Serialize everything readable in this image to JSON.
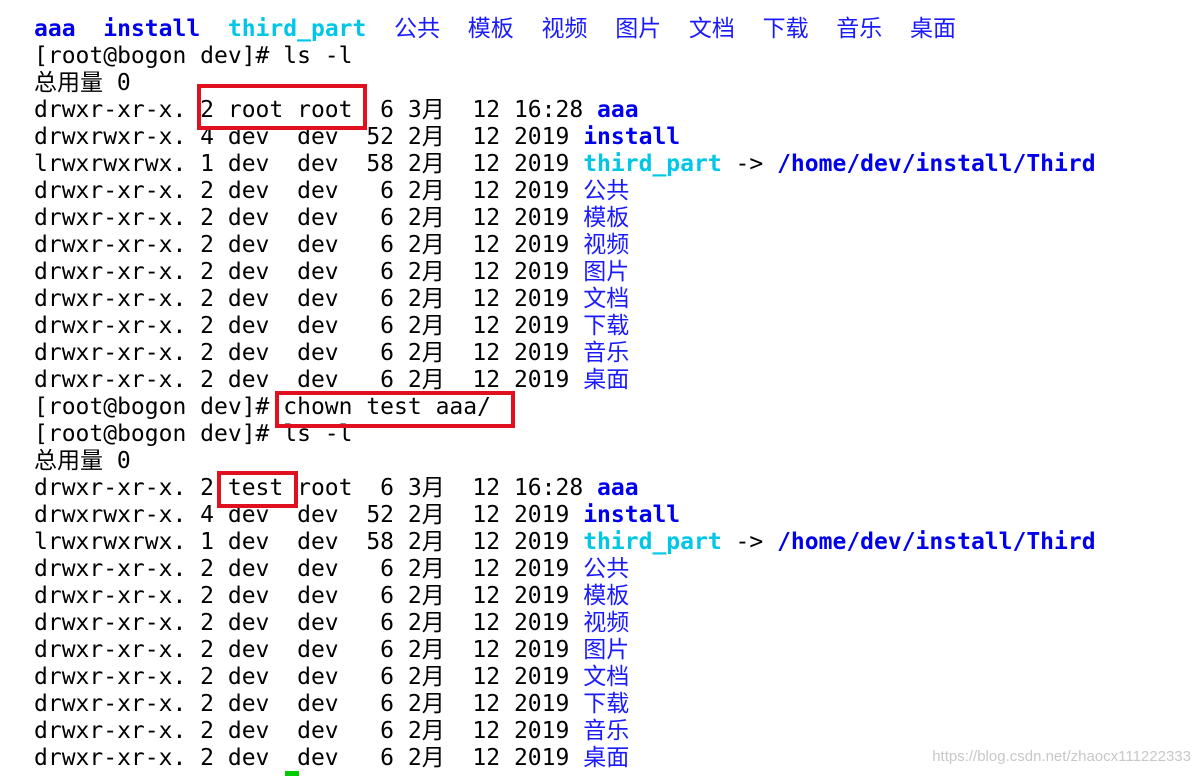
{
  "terminal": {
    "lines": [
      [
        {
          "t": "aaa",
          "s": "dir"
        },
        {
          "t": "  ",
          "s": "plain"
        },
        {
          "t": "install",
          "s": "dir"
        },
        {
          "t": "  ",
          "s": "plain"
        },
        {
          "t": "third_part",
          "s": "link"
        },
        {
          "t": "  ",
          "s": "plain"
        },
        {
          "t": "公共",
          "s": "cn"
        },
        {
          "t": "  ",
          "s": "plain"
        },
        {
          "t": "模板",
          "s": "cn"
        },
        {
          "t": "  ",
          "s": "plain"
        },
        {
          "t": "视频",
          "s": "cn"
        },
        {
          "t": "  ",
          "s": "plain"
        },
        {
          "t": "图片",
          "s": "cn"
        },
        {
          "t": "  ",
          "s": "plain"
        },
        {
          "t": "文档",
          "s": "cn"
        },
        {
          "t": "  ",
          "s": "plain"
        },
        {
          "t": "下载",
          "s": "cn"
        },
        {
          "t": "  ",
          "s": "plain"
        },
        {
          "t": "音乐",
          "s": "cn"
        },
        {
          "t": "  ",
          "s": "plain"
        },
        {
          "t": "桌面",
          "s": "cn"
        }
      ],
      [
        {
          "t": "[root@bogon dev]# ls -l",
          "s": "plain"
        }
      ],
      [
        {
          "t": "总用量 0",
          "s": "plain"
        }
      ],
      [
        {
          "t": "drwxr-xr-x. 2 root root  6 3月  12 16:28 ",
          "s": "plain"
        },
        {
          "t": "aaa",
          "s": "dir"
        }
      ],
      [
        {
          "t": "drwxrwxr-x. 4 dev  dev  52 2月  12 2019 ",
          "s": "plain"
        },
        {
          "t": "install",
          "s": "dir"
        }
      ],
      [
        {
          "t": "lrwxrwxrwx. 1 dev  dev  58 2月  12 2019 ",
          "s": "plain"
        },
        {
          "t": "third_part",
          "s": "link"
        },
        {
          "t": " -> ",
          "s": "plain"
        },
        {
          "t": "/home/dev/install/Third",
          "s": "dir"
        }
      ],
      [
        {
          "t": "drwxr-xr-x. 2 dev  dev   6 2月  12 2019 ",
          "s": "plain"
        },
        {
          "t": "公共",
          "s": "cn"
        }
      ],
      [
        {
          "t": "drwxr-xr-x. 2 dev  dev   6 2月  12 2019 ",
          "s": "plain"
        },
        {
          "t": "模板",
          "s": "cn"
        }
      ],
      [
        {
          "t": "drwxr-xr-x. 2 dev  dev   6 2月  12 2019 ",
          "s": "plain"
        },
        {
          "t": "视频",
          "s": "cn"
        }
      ],
      [
        {
          "t": "drwxr-xr-x. 2 dev  dev   6 2月  12 2019 ",
          "s": "plain"
        },
        {
          "t": "图片",
          "s": "cn"
        }
      ],
      [
        {
          "t": "drwxr-xr-x. 2 dev  dev   6 2月  12 2019 ",
          "s": "plain"
        },
        {
          "t": "文档",
          "s": "cn"
        }
      ],
      [
        {
          "t": "drwxr-xr-x. 2 dev  dev   6 2月  12 2019 ",
          "s": "plain"
        },
        {
          "t": "下载",
          "s": "cn"
        }
      ],
      [
        {
          "t": "drwxr-xr-x. 2 dev  dev   6 2月  12 2019 ",
          "s": "plain"
        },
        {
          "t": "音乐",
          "s": "cn"
        }
      ],
      [
        {
          "t": "drwxr-xr-x. 2 dev  dev   6 2月  12 2019 ",
          "s": "plain"
        },
        {
          "t": "桌面",
          "s": "cn"
        }
      ],
      [
        {
          "t": "[root@bogon dev]# chown test aaa/",
          "s": "plain"
        }
      ],
      [
        {
          "t": "[root@bogon dev]# ls -l",
          "s": "plain"
        }
      ],
      [
        {
          "t": "总用量 0",
          "s": "plain"
        }
      ],
      [
        {
          "t": "drwxr-xr-x. 2 test root  6 3月  12 16:28 ",
          "s": "plain"
        },
        {
          "t": "aaa",
          "s": "dir"
        }
      ],
      [
        {
          "t": "drwxrwxr-x. 4 dev  dev  52 2月  12 2019 ",
          "s": "plain"
        },
        {
          "t": "install",
          "s": "dir"
        }
      ],
      [
        {
          "t": "lrwxrwxrwx. 1 dev  dev  58 2月  12 2019 ",
          "s": "plain"
        },
        {
          "t": "third_part",
          "s": "link"
        },
        {
          "t": " -> ",
          "s": "plain"
        },
        {
          "t": "/home/dev/install/Third",
          "s": "dir"
        }
      ],
      [
        {
          "t": "drwxr-xr-x. 2 dev  dev   6 2月  12 2019 ",
          "s": "plain"
        },
        {
          "t": "公共",
          "s": "cn"
        }
      ],
      [
        {
          "t": "drwxr-xr-x. 2 dev  dev   6 2月  12 2019 ",
          "s": "plain"
        },
        {
          "t": "模板",
          "s": "cn"
        }
      ],
      [
        {
          "t": "drwxr-xr-x. 2 dev  dev   6 2月  12 2019 ",
          "s": "plain"
        },
        {
          "t": "视频",
          "s": "cn"
        }
      ],
      [
        {
          "t": "drwxr-xr-x. 2 dev  dev   6 2月  12 2019 ",
          "s": "plain"
        },
        {
          "t": "图片",
          "s": "cn"
        }
      ],
      [
        {
          "t": "drwxr-xr-x. 2 dev  dev   6 2月  12 2019 ",
          "s": "plain"
        },
        {
          "t": "文档",
          "s": "cn"
        }
      ],
      [
        {
          "t": "drwxr-xr-x. 2 dev  dev   6 2月  12 2019 ",
          "s": "plain"
        },
        {
          "t": "下载",
          "s": "cn"
        }
      ],
      [
        {
          "t": "drwxr-xr-x. 2 dev  dev   6 2月  12 2019 ",
          "s": "plain"
        },
        {
          "t": "音乐",
          "s": "cn"
        }
      ],
      [
        {
          "t": "drwxr-xr-x. 2 dev  dev   6 2月  12 2019 ",
          "s": "plain"
        },
        {
          "t": "桌面",
          "s": "cn"
        }
      ]
    ]
  },
  "watermark": "https://blog.csdn.net/zhaocx111222333",
  "colors": {
    "background": "#ffffff",
    "text": "#000000",
    "directory": "#0000ee",
    "symlink": "#00c7e6",
    "cjk_directory": "#1a1aff",
    "highlight_box": "#e0101e",
    "cursor": "#00cc00"
  }
}
